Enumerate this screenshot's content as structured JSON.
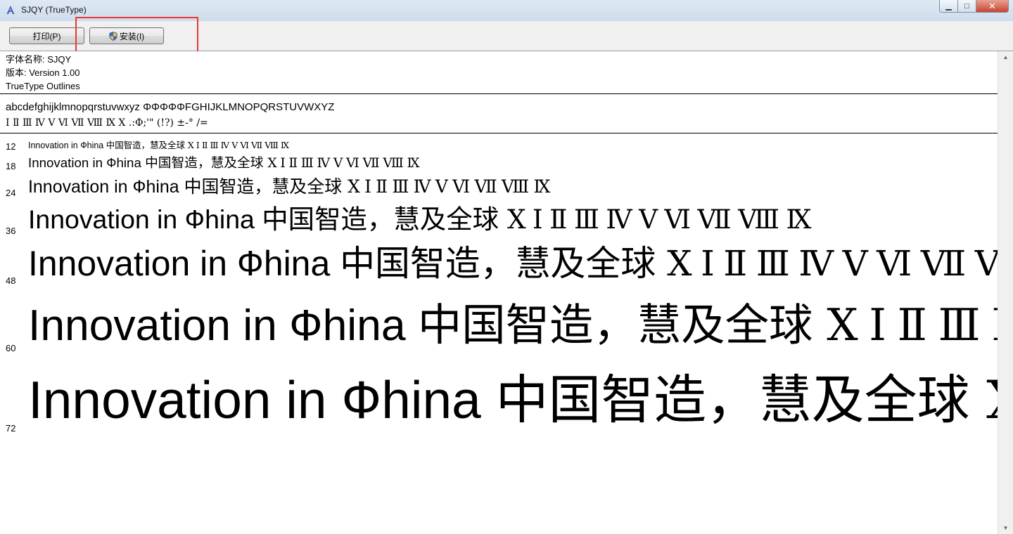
{
  "window": {
    "title": "SJQY (TrueType)",
    "minimize": "▁",
    "maximize": "□",
    "close": "✕"
  },
  "toolbar": {
    "print_label": "打印(P)",
    "install_label": "安装(I)"
  },
  "font_info": {
    "name_line": "字体名称: SJQY",
    "version_line": "版本: Version 1.00",
    "outline_line": "TrueType Outlines"
  },
  "charset": {
    "line1": "abcdefghijklmnopqrstuvwxyz ΦΦΦΦΦFGHIJKLMNOPQRSTUVWXYZ",
    "line2": "Ⅰ Ⅱ Ⅲ Ⅳ Ⅴ Ⅵ Ⅶ Ⅷ Ⅸ Ⅹ .:Φ;'\" (!?) ±-° /="
  },
  "samples": [
    {
      "size": "12",
      "latin": "Innovation in ",
      "glyph": "Ф",
      "latin2": "hina ",
      "cjk": "中国智造，慧及全球 ",
      "roman": "Ⅹ Ⅰ Ⅱ Ⅲ Ⅳ Ⅴ Ⅵ Ⅶ Ⅷ Ⅸ"
    },
    {
      "size": "18",
      "latin": "Innovation in ",
      "glyph": "Ф",
      "latin2": "hina ",
      "cjk": "中国智造，慧及全球 ",
      "roman": "Ⅹ Ⅰ Ⅱ Ⅲ Ⅳ Ⅴ Ⅵ Ⅶ Ⅷ Ⅸ"
    },
    {
      "size": "24",
      "latin": "Innovation in ",
      "glyph": "Ф",
      "latin2": "hina ",
      "cjk": "中国智造，慧及全球 ",
      "roman": "Ⅹ Ⅰ Ⅱ Ⅲ Ⅳ Ⅴ Ⅵ Ⅶ Ⅷ Ⅸ"
    },
    {
      "size": "36",
      "latin": "Innovation in ",
      "glyph": "Ф",
      "latin2": "hina ",
      "cjk": "中国智造，慧及全球 ",
      "roman": "Ⅹ Ⅰ Ⅱ Ⅲ Ⅳ Ⅴ Ⅵ Ⅶ Ⅷ Ⅸ"
    },
    {
      "size": "48",
      "latin": "Innovation in ",
      "glyph": "Ф",
      "latin2": "hina ",
      "cjk": "中国智造，慧及全球 ",
      "roman": "Ⅹ Ⅰ Ⅱ Ⅲ Ⅳ Ⅴ Ⅵ Ⅶ Ⅷ Ⅸ"
    },
    {
      "size": "60",
      "latin": "Innovation in ",
      "glyph": "Ф",
      "latin2": "hina ",
      "cjk": "中国智造，慧及全球 ",
      "roman": "Ⅹ Ⅰ Ⅱ Ⅲ Ⅳ Ⅴ Ⅵ Ⅶ Ⅷ Ⅸ"
    },
    {
      "size": "72",
      "latin": "Innovation in ",
      "glyph": "Ф",
      "latin2": "hina ",
      "cjk": "中国智造，慧及全球 ",
      "roman": "Ⅹ Ⅰ Ⅱ Ⅲ Ⅳ Ⅴ Ⅵ Ⅶ Ⅷ Ⅸ"
    }
  ],
  "colors": {
    "highlight_box": "#e53935",
    "titlebar": "#dfe9f5"
  }
}
